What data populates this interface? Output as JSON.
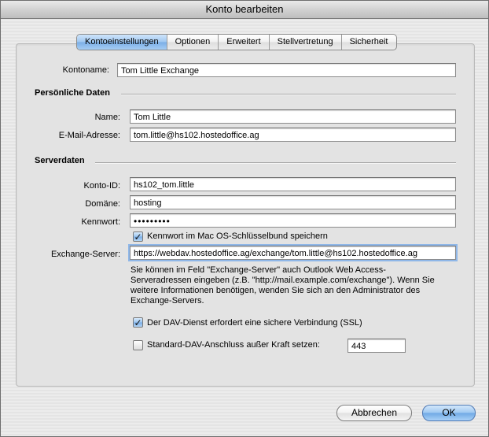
{
  "window": {
    "title": "Konto bearbeiten"
  },
  "tabs": [
    {
      "label": "Kontoeinstellungen",
      "active": true
    },
    {
      "label": "Optionen",
      "active": false
    },
    {
      "label": "Erweitert",
      "active": false
    },
    {
      "label": "Stellvertretung",
      "active": false
    },
    {
      "label": "Sicherheit",
      "active": false
    }
  ],
  "account": {
    "label": "Kontoname:",
    "value": "Tom Little Exchange"
  },
  "personal": {
    "heading": "Persönliche Daten",
    "name_label": "Name:",
    "name_value": "Tom Little",
    "email_label": "E-Mail-Adresse:",
    "email_value": "tom.little@hs102.hostedoffice.ag"
  },
  "server": {
    "heading": "Serverdaten",
    "id_label": "Konto-ID:",
    "id_value": "hs102_tom.little",
    "domain_label": "Domäne:",
    "domain_value": "hosting",
    "password_label": "Kennwort:",
    "password_value": "•••••••••",
    "keychain_label": "Kennwort im Mac OS-Schlüsselbund speichern",
    "keychain_checked": true,
    "exchange_label": "Exchange-Server:",
    "exchange_value": "https://webdav.hostedoffice.ag/exchange/tom.little@hs102.hostedoffice.ag",
    "help": "Sie können im Feld \"Exchange-Server\" auch Outlook Web Access-Serveradressen eingeben (z.B. \"http://mail.example.com/exchange\"). Wenn Sie weitere Informationen benötigen, wenden Sie sich an den Administrator des Exchange-Servers.",
    "ssl_label": "Der DAV-Dienst erfordert eine sichere Verbindung (SSL)",
    "ssl_checked": true,
    "port_override_label": "Standard-DAV-Anschluss außer Kraft setzen:",
    "port_override_checked": false,
    "port_value": "443"
  },
  "buttons": {
    "cancel": "Abbrechen",
    "ok": "OK"
  },
  "colors": {
    "accent": "#7aaee6",
    "focus_ring": "#8fb7e8"
  }
}
